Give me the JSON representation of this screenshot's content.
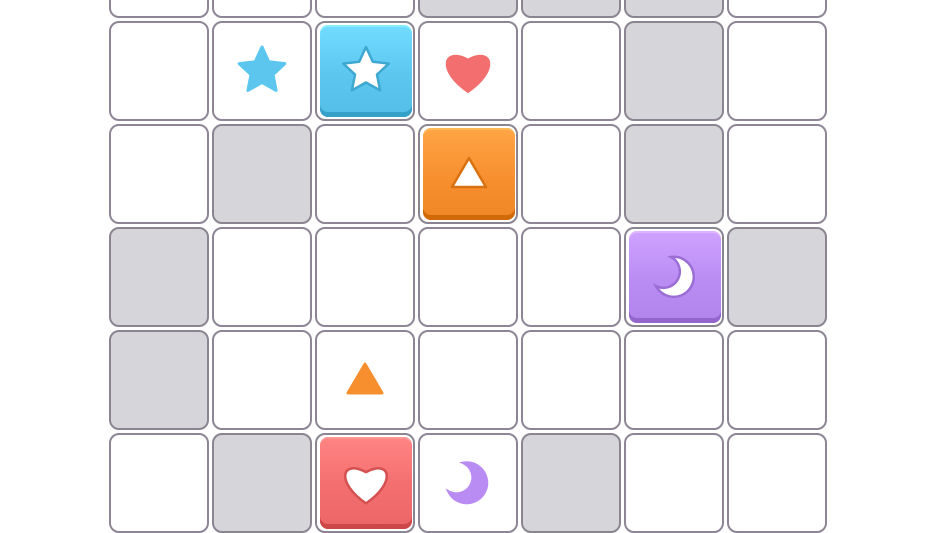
{
  "board": {
    "rows": 6,
    "cols": 7,
    "colors": {
      "blue": "#5cc6ef",
      "orange": "#f78f2f",
      "purple": "#b98cf3",
      "red": "#f36e6e",
      "blocked": "#d6d6da",
      "border": "#8e8696"
    },
    "cells": [
      [
        {
          "type": "empty"
        },
        {
          "type": "empty"
        },
        {
          "type": "empty"
        },
        {
          "type": "blocked"
        },
        {
          "type": "blocked"
        },
        {
          "type": "blocked"
        },
        {
          "type": "empty"
        }
      ],
      [
        {
          "type": "empty"
        },
        {
          "type": "target",
          "shape": "star",
          "color": "blue"
        },
        {
          "type": "tile",
          "shape": "star",
          "color": "blue"
        },
        {
          "type": "target",
          "shape": "heart",
          "color": "red"
        },
        {
          "type": "empty"
        },
        {
          "type": "blocked"
        },
        {
          "type": "empty"
        }
      ],
      [
        {
          "type": "empty"
        },
        {
          "type": "blocked"
        },
        {
          "type": "empty"
        },
        {
          "type": "tile",
          "shape": "triangle",
          "color": "orange"
        },
        {
          "type": "empty"
        },
        {
          "type": "blocked"
        },
        {
          "type": "empty"
        }
      ],
      [
        {
          "type": "blocked"
        },
        {
          "type": "empty"
        },
        {
          "type": "empty"
        },
        {
          "type": "empty"
        },
        {
          "type": "empty"
        },
        {
          "type": "tile",
          "shape": "moon",
          "color": "purple"
        },
        {
          "type": "blocked"
        }
      ],
      [
        {
          "type": "blocked"
        },
        {
          "type": "empty"
        },
        {
          "type": "target",
          "shape": "triangle",
          "color": "orange"
        },
        {
          "type": "empty"
        },
        {
          "type": "empty"
        },
        {
          "type": "empty"
        },
        {
          "type": "empty"
        }
      ],
      [
        {
          "type": "empty"
        },
        {
          "type": "blocked"
        },
        {
          "type": "tile",
          "shape": "heart",
          "color": "red"
        },
        {
          "type": "target",
          "shape": "moon",
          "color": "purple"
        },
        {
          "type": "blocked"
        },
        {
          "type": "empty"
        },
        {
          "type": "empty"
        }
      ]
    ]
  }
}
